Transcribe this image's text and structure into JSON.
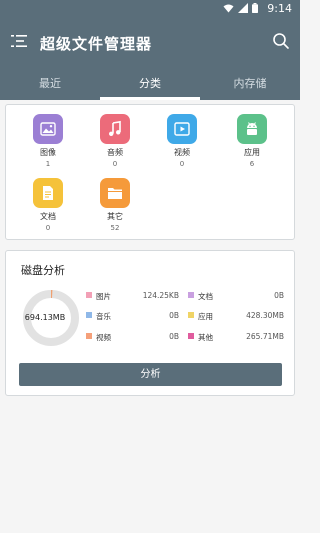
{
  "status": {
    "time": "9:14"
  },
  "app": {
    "title": "超级文件管理器"
  },
  "tabs": [
    {
      "label": "最近"
    },
    {
      "label": "分类"
    },
    {
      "label": "内存储"
    }
  ],
  "categories": [
    {
      "label": "图像",
      "count": "1",
      "icon": "image-icon",
      "color": "#9b7fd4"
    },
    {
      "label": "音频",
      "count": "0",
      "icon": "music-icon",
      "color": "#ec6b7a"
    },
    {
      "label": "视频",
      "count": "0",
      "icon": "video-icon",
      "color": "#3fa9e8"
    },
    {
      "label": "应用",
      "count": "6",
      "icon": "android-icon",
      "color": "#5cc18a"
    },
    {
      "label": "文档",
      "count": "0",
      "icon": "document-icon",
      "color": "#f5c23a"
    },
    {
      "label": "其它",
      "count": "52",
      "icon": "folder-icon",
      "color": "#f59a3a"
    }
  ],
  "disk": {
    "title": "磁盘分析",
    "total": "694.13MB",
    "legend": [
      {
        "name": "图片",
        "value": "124.25KB",
        "color": "#f2a0b6"
      },
      {
        "name": "文档",
        "value": "0B",
        "color": "#c9a0e0"
      },
      {
        "name": "音乐",
        "value": "0B",
        "color": "#8fb8e8"
      },
      {
        "name": "应用",
        "value": "428.30MB",
        "color": "#f0d466"
      },
      {
        "name": "视频",
        "value": "0B",
        "color": "#f5a07a"
      },
      {
        "name": "其他",
        "value": "265.71MB",
        "color": "#e05c9e"
      }
    ],
    "analyze_label": "分析"
  }
}
